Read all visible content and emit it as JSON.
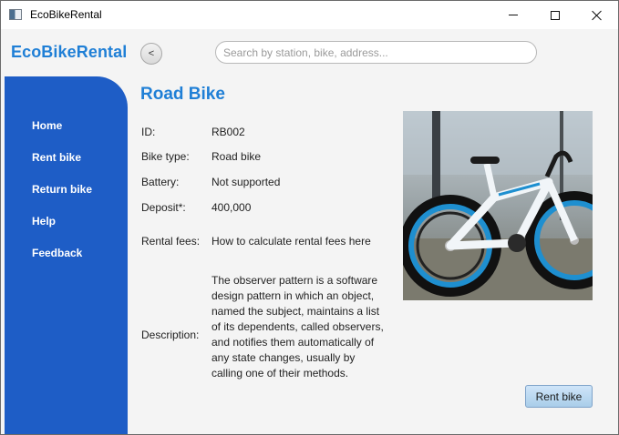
{
  "window": {
    "title": "EcoBikeRental",
    "controls": {
      "minimize": "minimize-icon",
      "maximize": "maximize-icon",
      "close": "close-icon"
    }
  },
  "header": {
    "brand": "EcoBikeRental",
    "back_label": "<",
    "search": {
      "placeholder": "Search by station, bike, address...",
      "value": ""
    }
  },
  "sidebar": {
    "color": "#1e5dc6",
    "items": [
      {
        "label": "Home"
      },
      {
        "label": "Rent bike"
      },
      {
        "label": "Return bike"
      },
      {
        "label": "Help"
      },
      {
        "label": "Feedback"
      }
    ]
  },
  "main": {
    "title": "Road Bike",
    "fields": {
      "id_label": "ID:",
      "id_value": "RB002",
      "type_label": "Bike type:",
      "type_value": "Road bike",
      "battery_label": "Battery:",
      "battery_value": "Not supported",
      "deposit_label": "Deposit*:",
      "deposit_value": "400,000",
      "fees_label": "Rental fees:",
      "fees_value": "How to calculate rental fees here",
      "description_label": "Description:",
      "description_value": "The observer pattern is a software design pattern in which an object, named the subject, maintains a list of its dependents, called observers, and notifies them automatically of any state changes, usually by calling one of their methods."
    },
    "rent_button": "Rent bike"
  },
  "colors": {
    "accent": "#1f7fd6",
    "sidebar": "#1e5dc6",
    "background": "#f4f4f4"
  }
}
